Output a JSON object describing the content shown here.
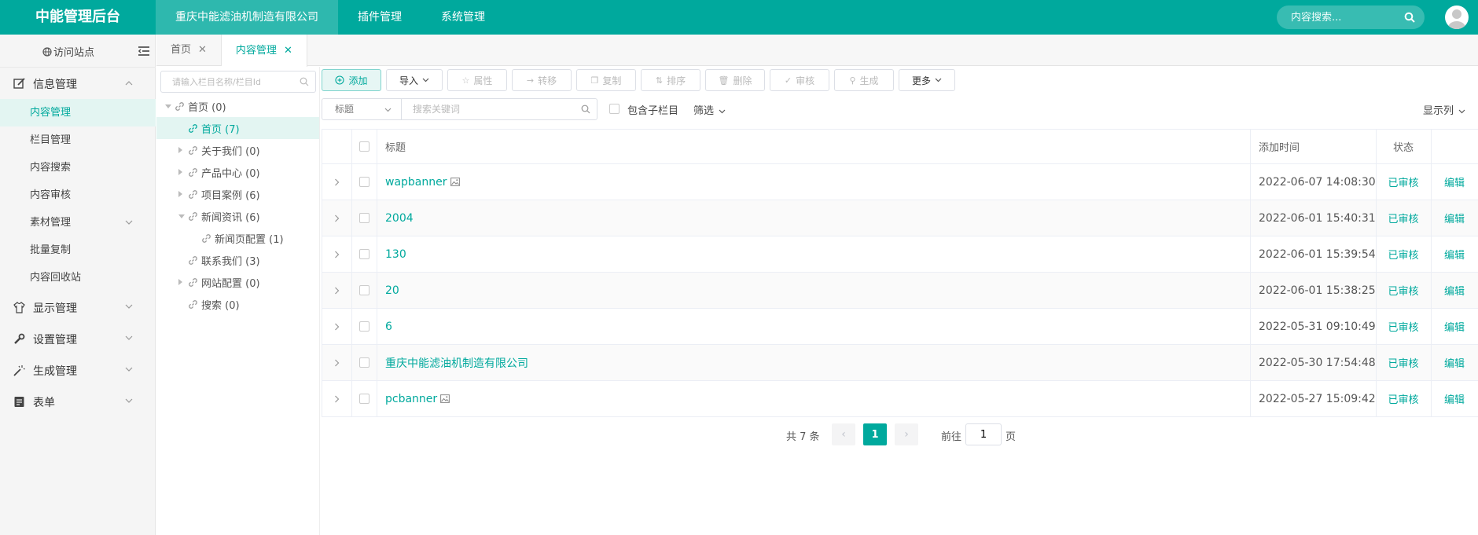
{
  "header": {
    "brand": "中能管理后台",
    "nav": [
      {
        "label": "重庆中能滤油机制造有限公司",
        "active": true
      },
      {
        "label": "插件管理",
        "active": false
      },
      {
        "label": "系统管理",
        "active": false
      }
    ],
    "search_placeholder": "内容搜索...",
    "accent_color": "#00a99d"
  },
  "sidebar": {
    "visit_site": "访问站点",
    "groups": [
      {
        "label": "信息管理",
        "icon": "edit-icon",
        "expanded": true,
        "items": [
          "内容管理",
          "栏目管理",
          "内容搜索",
          "内容审核",
          "素材管理",
          "批量复制",
          "内容回收站"
        ]
      },
      {
        "label": "显示管理",
        "icon": "shirt-icon",
        "expanded": false
      },
      {
        "label": "设置管理",
        "icon": "wrench-icon",
        "expanded": false
      },
      {
        "label": "生成管理",
        "icon": "magic-wand-icon",
        "expanded": false
      },
      {
        "label": "表单",
        "icon": "form-icon",
        "expanded": false
      }
    ],
    "active_item": "内容管理"
  },
  "tabs": [
    {
      "label": "首页",
      "active": false
    },
    {
      "label": "内容管理",
      "active": true
    }
  ],
  "tree": {
    "search_placeholder": "请输入栏目名称/栏目Id",
    "nodes": [
      {
        "label": "首页 (0)",
        "level": 0,
        "arrow": "down"
      },
      {
        "label": "首页 (7)",
        "level": 1,
        "arrow": "none",
        "active": true
      },
      {
        "label": "关于我们 (0)",
        "level": 1,
        "arrow": "right"
      },
      {
        "label": "产品中心 (0)",
        "level": 1,
        "arrow": "right"
      },
      {
        "label": "项目案例 (6)",
        "level": 1,
        "arrow": "right"
      },
      {
        "label": "新闻资讯 (6)",
        "level": 1,
        "arrow": "down"
      },
      {
        "label": "新闻页配置 (1)",
        "level": 2,
        "arrow": "none"
      },
      {
        "label": "联系我们 (3)",
        "level": 1,
        "arrow": "none"
      },
      {
        "label": "网站配置 (0)",
        "level": 1,
        "arrow": "right"
      },
      {
        "label": "搜索 (0)",
        "level": 1,
        "arrow": "none"
      }
    ]
  },
  "toolbar": {
    "buttons": [
      {
        "label": "添加",
        "icon": "plus-circle-icon"
      },
      {
        "label": "导入",
        "icon": "chevron-down-icon"
      },
      {
        "label": "属性",
        "icon": "star-icon"
      },
      {
        "label": "转移",
        "icon": "arrow-right-icon"
      },
      {
        "label": "复制",
        "icon": "copy-icon"
      },
      {
        "label": "排序",
        "icon": "sort-icon"
      },
      {
        "label": "删除",
        "icon": "trash-icon"
      },
      {
        "label": "审核",
        "icon": "check-circle-icon"
      },
      {
        "label": "生成",
        "icon": "wand-icon"
      },
      {
        "label": "更多",
        "icon": "chevron-down-icon"
      }
    ]
  },
  "filter": {
    "field_select": "标题",
    "keyword_placeholder": "搜索关键词",
    "include_sub": "包含子栏目",
    "screen": "筛选",
    "show_columns": "显示列"
  },
  "table": {
    "columns": [
      "标题",
      "添加时间",
      "状态"
    ],
    "rows": [
      {
        "title": "wapbanner",
        "image": true,
        "time": "2022-06-07 14:08:30",
        "status": "已审核",
        "action": "编辑"
      },
      {
        "title": "2004",
        "image": false,
        "time": "2022-06-01 15:40:31",
        "status": "已审核",
        "action": "编辑"
      },
      {
        "title": "130",
        "image": false,
        "time": "2022-06-01 15:39:54",
        "status": "已审核",
        "action": "编辑"
      },
      {
        "title": "20",
        "image": false,
        "time": "2022-06-01 15:38:25",
        "status": "已审核",
        "action": "编辑"
      },
      {
        "title": "6",
        "image": false,
        "time": "2022-05-31 09:10:49",
        "status": "已审核",
        "action": "编辑"
      },
      {
        "title": "重庆中能滤油机制造有限公司",
        "image": false,
        "time": "2022-05-30 17:54:48",
        "status": "已审核",
        "action": "编辑"
      },
      {
        "title": "pcbanner",
        "image": true,
        "time": "2022-05-27 15:09:42",
        "status": "已审核",
        "action": "编辑"
      }
    ]
  },
  "pagination": {
    "total": "共 7 条",
    "current": "1",
    "goto": "前往",
    "goto_value": "1",
    "page_word": "页"
  }
}
